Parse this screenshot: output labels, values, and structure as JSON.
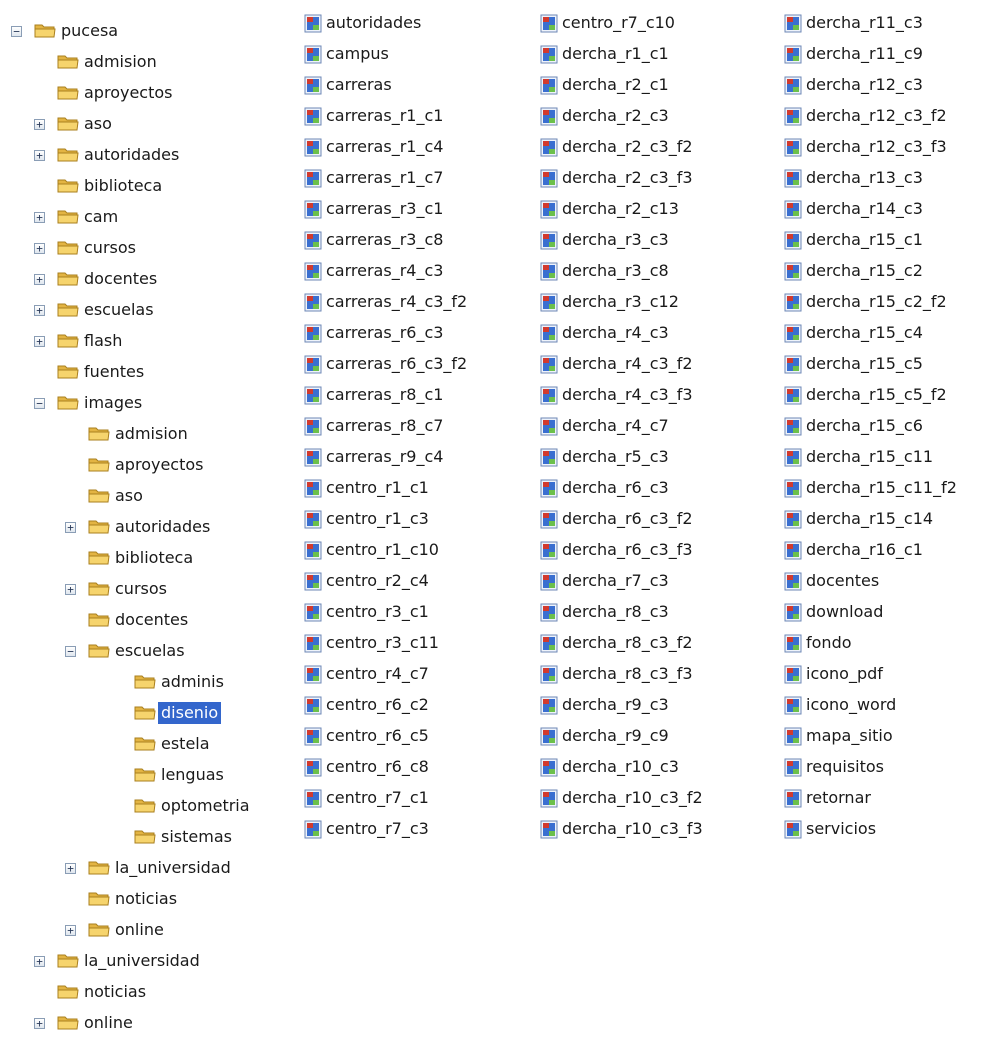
{
  "tree": {
    "items": [
      {
        "label": "pucesa",
        "level": 0,
        "expander": "minus",
        "selected": false
      },
      {
        "label": "admision",
        "level": 1,
        "expander": "",
        "selected": false
      },
      {
        "label": "aproyectos",
        "level": 1,
        "expander": "",
        "selected": false
      },
      {
        "label": "aso",
        "level": 1,
        "expander": "plus",
        "selected": false
      },
      {
        "label": "autoridades",
        "level": 1,
        "expander": "plus",
        "selected": false
      },
      {
        "label": "biblioteca",
        "level": 1,
        "expander": "",
        "selected": false
      },
      {
        "label": "cam",
        "level": 1,
        "expander": "plus",
        "selected": false
      },
      {
        "label": "cursos",
        "level": 1,
        "expander": "plus",
        "selected": false
      },
      {
        "label": "docentes",
        "level": 1,
        "expander": "plus",
        "selected": false
      },
      {
        "label": "escuelas",
        "level": 1,
        "expander": "plus",
        "selected": false
      },
      {
        "label": "flash",
        "level": 1,
        "expander": "plus",
        "selected": false
      },
      {
        "label": "fuentes",
        "level": 1,
        "expander": "",
        "selected": false
      },
      {
        "label": "images",
        "level": 1,
        "expander": "minus",
        "selected": false
      },
      {
        "label": "admision",
        "level": 2,
        "expander": "",
        "selected": false
      },
      {
        "label": "aproyectos",
        "level": 2,
        "expander": "",
        "selected": false
      },
      {
        "label": "aso",
        "level": 2,
        "expander": "",
        "selected": false
      },
      {
        "label": "autoridades",
        "level": 2,
        "expander": "plus",
        "selected": false
      },
      {
        "label": "biblioteca",
        "level": 2,
        "expander": "",
        "selected": false
      },
      {
        "label": "cursos",
        "level": 2,
        "expander": "plus",
        "selected": false
      },
      {
        "label": "docentes",
        "level": 2,
        "expander": "",
        "selected": false
      },
      {
        "label": "escuelas",
        "level": 2,
        "expander": "minus",
        "selected": false
      },
      {
        "label": "adminis",
        "level": 3,
        "expander": "",
        "selected": false
      },
      {
        "label": "disenio",
        "level": 3,
        "expander": "",
        "selected": true
      },
      {
        "label": "estela",
        "level": 3,
        "expander": "",
        "selected": false
      },
      {
        "label": "lenguas",
        "level": 3,
        "expander": "",
        "selected": false
      },
      {
        "label": "optometria",
        "level": 3,
        "expander": "",
        "selected": false
      },
      {
        "label": "sistemas",
        "level": 3,
        "expander": "",
        "selected": false
      },
      {
        "label": "la_universidad",
        "level": 2,
        "expander": "plus",
        "selected": false
      },
      {
        "label": "noticias",
        "level": 2,
        "expander": "",
        "selected": false
      },
      {
        "label": "online",
        "level": 2,
        "expander": "plus",
        "selected": false
      },
      {
        "label": "la_universidad",
        "level": 1,
        "expander": "plus",
        "selected": false
      },
      {
        "label": "noticias",
        "level": 1,
        "expander": "",
        "selected": false
      },
      {
        "label": "online",
        "level": 1,
        "expander": "plus",
        "selected": false
      }
    ]
  },
  "files": {
    "columns": [
      [
        "autoridades",
        "campus",
        "carreras",
        "carreras_r1_c1",
        "carreras_r1_c4",
        "carreras_r1_c7",
        "carreras_r3_c1",
        "carreras_r3_c8",
        "carreras_r4_c3",
        "carreras_r4_c3_f2",
        "carreras_r6_c3",
        "carreras_r6_c3_f2",
        "carreras_r8_c1",
        "carreras_r8_c7",
        "carreras_r9_c4",
        "centro_r1_c1",
        "centro_r1_c3",
        "centro_r1_c10",
        "centro_r2_c4",
        "centro_r3_c1",
        "centro_r3_c11",
        "centro_r4_c7",
        "centro_r6_c2",
        "centro_r6_c5",
        "centro_r6_c8",
        "centro_r7_c1",
        "centro_r7_c3"
      ],
      [
        "centro_r7_c10",
        "dercha_r1_c1",
        "dercha_r2_c1",
        "dercha_r2_c3",
        "dercha_r2_c3_f2",
        "dercha_r2_c3_f3",
        "dercha_r2_c13",
        "dercha_r3_c3",
        "dercha_r3_c8",
        "dercha_r3_c12",
        "dercha_r4_c3",
        "dercha_r4_c3_f2",
        "dercha_r4_c3_f3",
        "dercha_r4_c7",
        "dercha_r5_c3",
        "dercha_r6_c3",
        "dercha_r6_c3_f2",
        "dercha_r6_c3_f3",
        "dercha_r7_c3",
        "dercha_r8_c3",
        "dercha_r8_c3_f2",
        "dercha_r8_c3_f3",
        "dercha_r9_c3",
        "dercha_r9_c9",
        "dercha_r10_c3",
        "dercha_r10_c3_f2",
        "dercha_r10_c3_f3"
      ],
      [
        "dercha_r11_c3",
        "dercha_r11_c9",
        "dercha_r12_c3",
        "dercha_r12_c3_f2",
        "dercha_r12_c3_f3",
        "dercha_r13_c3",
        "dercha_r14_c3",
        "dercha_r15_c1",
        "dercha_r15_c2",
        "dercha_r15_c2_f2",
        "dercha_r15_c4",
        "dercha_r15_c5",
        "dercha_r15_c5_f2",
        "dercha_r15_c6",
        "dercha_r15_c11",
        "dercha_r15_c11_f2",
        "dercha_r15_c14",
        "dercha_r16_c1",
        "docentes",
        "download",
        "fondo",
        "icono_pdf",
        "icono_word",
        "mapa_sitio",
        "requisitos",
        "retornar",
        "servicios"
      ]
    ]
  },
  "colors": {
    "selection": "#3366cc",
    "folder": "#f3cf63",
    "file_icon": "#3a6fd0"
  },
  "icons": {
    "folder": "folder-icon",
    "file": "image-file-icon",
    "expand": "expand-plus-icon",
    "collapse": "collapse-minus-icon"
  }
}
